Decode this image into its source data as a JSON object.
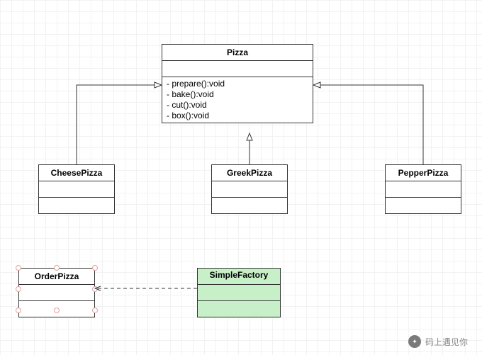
{
  "nodes": {
    "pizza": {
      "name": "Pizza",
      "methods": [
        "- prepare():void",
        "- bake():void",
        "- cut():void",
        "- box():void"
      ]
    },
    "cheese": {
      "name": "CheesePizza"
    },
    "greek": {
      "name": "GreekPizza"
    },
    "pepper": {
      "name": "PepperPizza"
    },
    "order": {
      "name": "OrderPizza"
    },
    "factory": {
      "name": "SimpleFactory"
    }
  },
  "watermark": "码上遇见你"
}
